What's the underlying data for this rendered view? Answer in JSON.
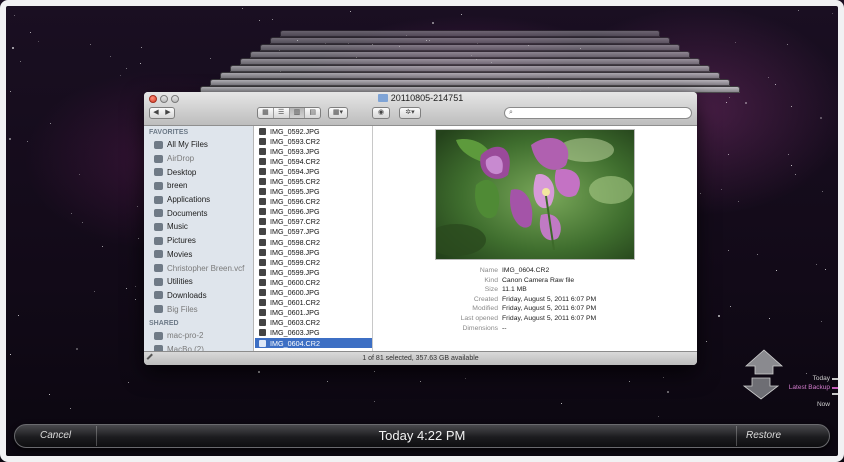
{
  "window": {
    "title": "20110805-214751",
    "search_placeholder": "",
    "back_label": "◀",
    "forward_label": "▶",
    "quicklook_icon": "eye-icon",
    "action_icon": "gear-icon"
  },
  "sidebar": {
    "favorites_heading": "FAVORITES",
    "shared_heading": "SHARED",
    "favorites": [
      {
        "label": "All My Files",
        "icon": "all-files-icon",
        "dim": false
      },
      {
        "label": "AirDrop",
        "icon": "airdrop-icon",
        "dim": true
      },
      {
        "label": "Desktop",
        "icon": "desktop-icon",
        "dim": false
      },
      {
        "label": "breen",
        "icon": "home-icon",
        "dim": false
      },
      {
        "label": "Applications",
        "icon": "applications-icon",
        "dim": false
      },
      {
        "label": "Documents",
        "icon": "documents-icon",
        "dim": false
      },
      {
        "label": "Music",
        "icon": "music-icon",
        "dim": false
      },
      {
        "label": "Pictures",
        "icon": "pictures-icon",
        "dim": false
      },
      {
        "label": "Movies",
        "icon": "movies-icon",
        "dim": false
      },
      {
        "label": "Christopher Breen.vcf",
        "icon": "file-icon",
        "dim": true
      },
      {
        "label": "Utilities",
        "icon": "utilities-icon",
        "dim": false
      },
      {
        "label": "Downloads",
        "icon": "downloads-icon",
        "dim": false
      },
      {
        "label": "Big Files",
        "icon": "gear-icon",
        "dim": true
      }
    ],
    "shared": [
      {
        "label": "mac-pro-2",
        "icon": "computer-icon",
        "dim": true
      },
      {
        "label": "MacBo (2)",
        "icon": "computer-icon",
        "dim": true
      }
    ]
  },
  "files": [
    {
      "name": "IMG_0592.JPG",
      "selected": false
    },
    {
      "name": "IMG_0593.CR2",
      "selected": false
    },
    {
      "name": "IMG_0593.JPG",
      "selected": false
    },
    {
      "name": "IMG_0594.CR2",
      "selected": false
    },
    {
      "name": "IMG_0594.JPG",
      "selected": false
    },
    {
      "name": "IMG_0595.CR2",
      "selected": false
    },
    {
      "name": "IMG_0595.JPG",
      "selected": false
    },
    {
      "name": "IMG_0596.CR2",
      "selected": false
    },
    {
      "name": "IMG_0596.JPG",
      "selected": false
    },
    {
      "name": "IMG_0597.CR2",
      "selected": false
    },
    {
      "name": "IMG_0597.JPG",
      "selected": false
    },
    {
      "name": "IMG_0598.CR2",
      "selected": false
    },
    {
      "name": "IMG_0598.JPG",
      "selected": false
    },
    {
      "name": "IMG_0599.CR2",
      "selected": false
    },
    {
      "name": "IMG_0599.JPG",
      "selected": false
    },
    {
      "name": "IMG_0600.CR2",
      "selected": false
    },
    {
      "name": "IMG_0600.JPG",
      "selected": false
    },
    {
      "name": "IMG_0601.CR2",
      "selected": false
    },
    {
      "name": "IMG_0601.JPG",
      "selected": false
    },
    {
      "name": "IMG_0603.CR2",
      "selected": false
    },
    {
      "name": "IMG_0603.JPG",
      "selected": false
    },
    {
      "name": "IMG_0604.CR2",
      "selected": true
    }
  ],
  "info": [
    {
      "key": "Name",
      "value": "IMG_0604.CR2"
    },
    {
      "key": "Kind",
      "value": "Canon Camera Raw file"
    },
    {
      "key": "Size",
      "value": "11.1 MB"
    },
    {
      "key": "Created",
      "value": "Friday, August 5, 2011 6:07 PM"
    },
    {
      "key": "Modified",
      "value": "Friday, August 5, 2011 6:07 PM"
    },
    {
      "key": "Last opened",
      "value": "Friday, August 5, 2011 6:07 PM"
    },
    {
      "key": "Dimensions",
      "value": "--"
    }
  ],
  "status": "1 of 81 selected, 357.63 GB available",
  "timeline": {
    "today": "Today",
    "latest_backup": "Latest Backup",
    "now": "Now"
  },
  "bottom": {
    "cancel": "Cancel",
    "time": "Today 4:22 PM",
    "restore": "Restore"
  },
  "colors": {
    "selection": "#3d6fc4",
    "sidebar_bg": "#dfe5ec",
    "timeline_accent": "#c25ab8"
  }
}
